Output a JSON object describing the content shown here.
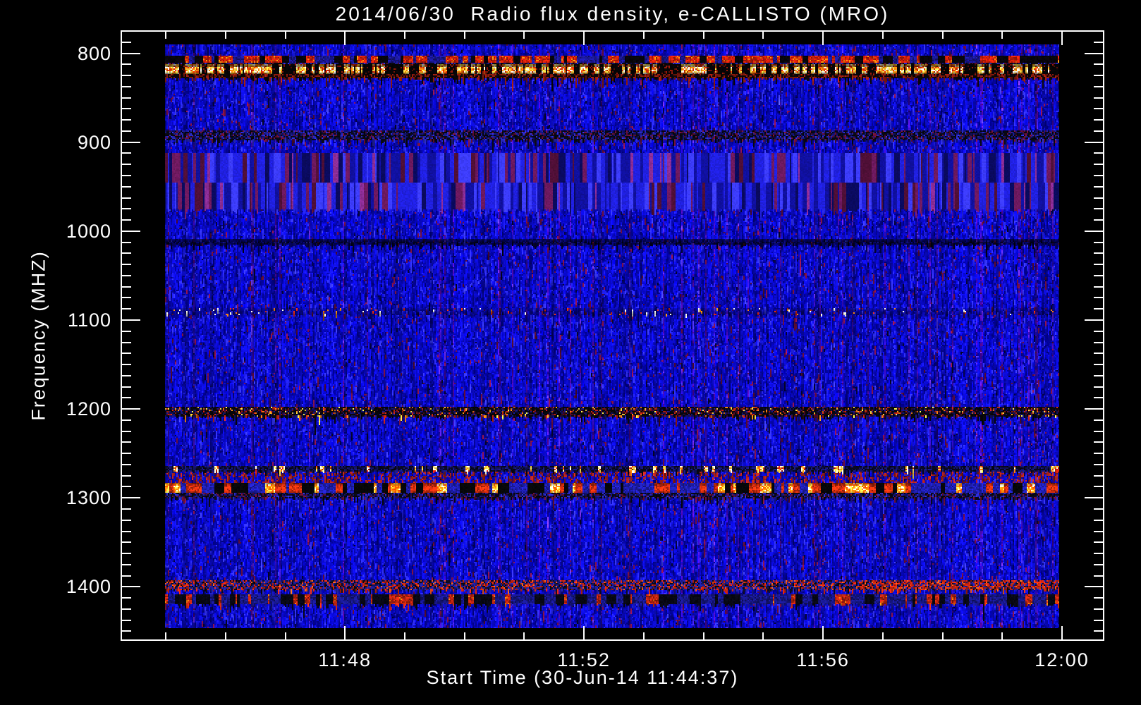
{
  "page": {
    "background_color": "#000000",
    "text_color": "#ffffff"
  },
  "chart_data": {
    "type": "heatmap",
    "subtype": "radio-spectrogram",
    "title": "2014/06/30  Radio flux density, e-CALLISTO (MRO)",
    "xlabel": "Start Time (30-Jun-14 11:44:37)",
    "ylabel": "Frequency (MHZ)",
    "observation": {
      "date": "2014/06/30",
      "quantity": "Radio flux density",
      "network": "e-CALLISTO",
      "station": "MRO",
      "start_time": "30-Jun-14 11:44:37"
    },
    "x_axis": {
      "unit": "time (HH:MM)",
      "first_tick_min": 45,
      "last_tick_min": 60,
      "minor_tick_step_min": 1,
      "major_ticks": [
        {
          "minute": 48,
          "label": "11:48"
        },
        {
          "minute": 52,
          "label": "11:52"
        },
        {
          "minute": 56,
          "label": "11:56"
        },
        {
          "minute": 60,
          "label": "12:00"
        }
      ]
    },
    "y_axis": {
      "unit": "MHz",
      "inverted": "low frequency at top",
      "range_mhz": [
        790,
        1448
      ],
      "minor_tick_step_mhz": 12.5,
      "major_ticks": [
        {
          "mhz": 800,
          "label": "800"
        },
        {
          "mhz": 900,
          "label": "900"
        },
        {
          "mhz": 1000,
          "label": "1000"
        },
        {
          "mhz": 1100,
          "label": "1100"
        },
        {
          "mhz": 1200,
          "label": "1200"
        },
        {
          "mhz": 1300,
          "label": "1300"
        },
        {
          "mhz": 1400,
          "label": "1400"
        }
      ]
    },
    "colormap": {
      "background_noise": "#2222dd",
      "dark": "#000000",
      "maroon": "#6e0f3c",
      "red": "#cd230c",
      "orange": "#ff820a",
      "yellow": "#ffdc46",
      "white": "#ffffeb"
    },
    "background_texture": "blue noise with vertical scan striping and sparse maroon speckles",
    "bands": [
      {
        "f0_mhz": 802,
        "f1_mhz": 810,
        "style": "redSpeckle",
        "desc": "intermittent red/black burst lane"
      },
      {
        "f0_mhz": 810,
        "f1_mhz": 813,
        "style": "darkMottle",
        "desc": "thin dark mottled gap"
      },
      {
        "f0_mhz": 813,
        "f1_mhz": 823,
        "style": "bright",
        "desc": "strongest lane: dense white/yellow/orange bursts on black"
      },
      {
        "f0_mhz": 823,
        "f1_mhz": 828,
        "style": "darkRed",
        "desc": "dark red/black fade"
      },
      {
        "f0_mhz": 887,
        "f1_mhz": 898,
        "style": "darkMottle",
        "desc": "dark mottled lane near 890 MHz"
      },
      {
        "f0_mhz": 912,
        "f1_mhz": 945,
        "style": "columnar",
        "desc": "vertically striped band, blue/purple columns"
      },
      {
        "f0_mhz": 945,
        "f1_mhz": 976,
        "style": "columnar2",
        "desc": "second vertically striped band"
      },
      {
        "f0_mhz": 1009,
        "f1_mhz": 1015,
        "style": "faintDark",
        "desc": "faint dark line"
      },
      {
        "f0_mhz": 1087,
        "f1_mhz": 1094,
        "style": "sparseDots",
        "desc": "sparse bright red/white dots"
      },
      {
        "f0_mhz": 1198,
        "f1_mhz": 1208,
        "style": "darkSpeckle",
        "desc": "dark lane with small red/orange/yellow speckles"
      },
      {
        "f0_mhz": 1264,
        "f1_mhz": 1271,
        "style": "dashLine",
        "desc": "dashed bright white/yellow line"
      },
      {
        "f0_mhz": 1271,
        "f1_mhz": 1283,
        "style": "redNoise",
        "desc": "red-tinged noise"
      },
      {
        "f0_mhz": 1283,
        "f1_mhz": 1295,
        "style": "blobs",
        "desc": "strong lane with orange/yellow blobs and black gaps"
      },
      {
        "f0_mhz": 1295,
        "f1_mhz": 1301,
        "style": "darkMottle",
        "desc": "dark lane"
      },
      {
        "f0_mhz": 1393,
        "f1_mhz": 1403,
        "style": "redBand",
        "desc": "red burst lane, densest at right edge"
      },
      {
        "f0_mhz": 1408,
        "f1_mhz": 1419,
        "style": "redSpeckle2",
        "desc": "red/dark speckled lane"
      }
    ]
  }
}
